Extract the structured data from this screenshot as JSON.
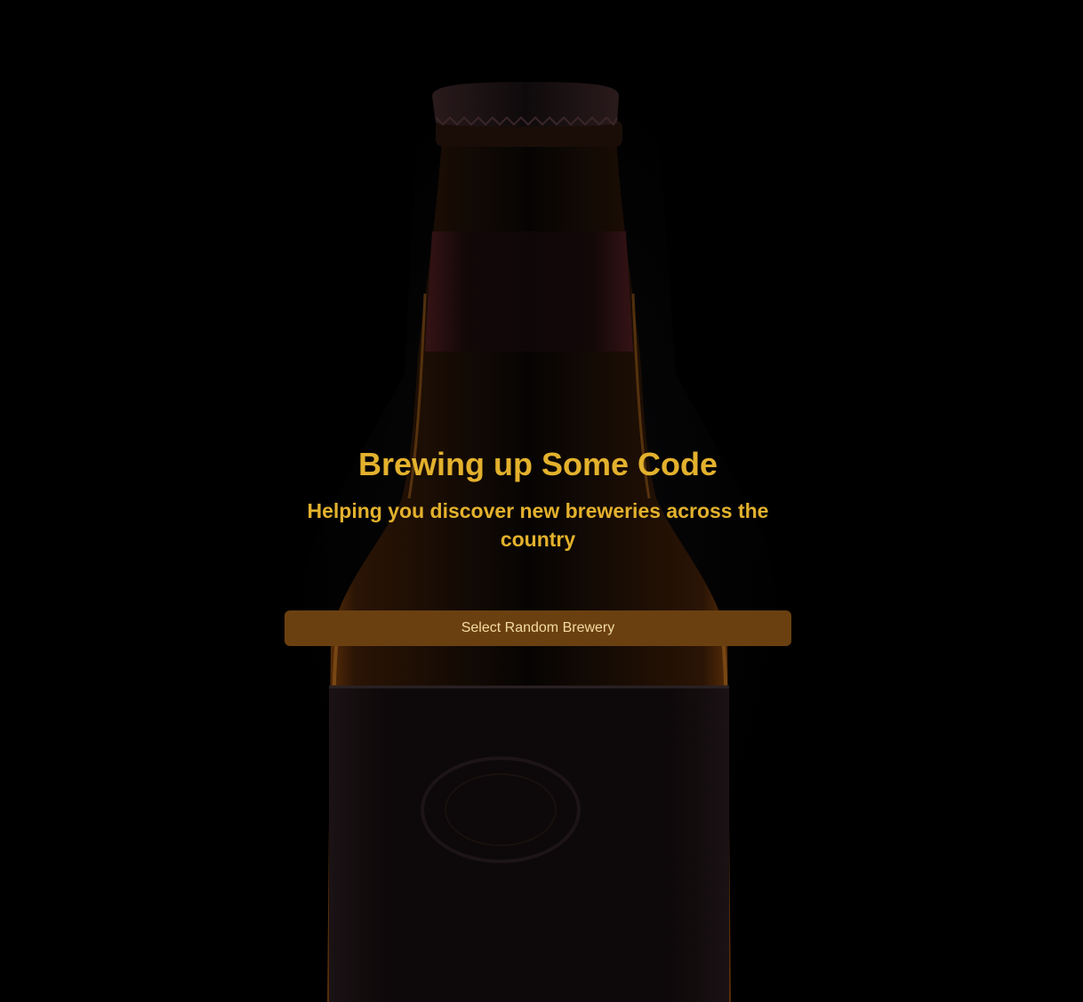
{
  "hero": {
    "title": "Brewing up Some Code",
    "subtitle": "Helping you discover new breweries across the country"
  },
  "actions": {
    "random_button_label": "Select Random Brewery"
  },
  "background": {
    "image": "beer-bottle-silhouette"
  },
  "colors": {
    "background": "#000000",
    "accent_text": "#e3b12d",
    "button_background": "#6b4010",
    "button_text": "#f3dca0"
  }
}
